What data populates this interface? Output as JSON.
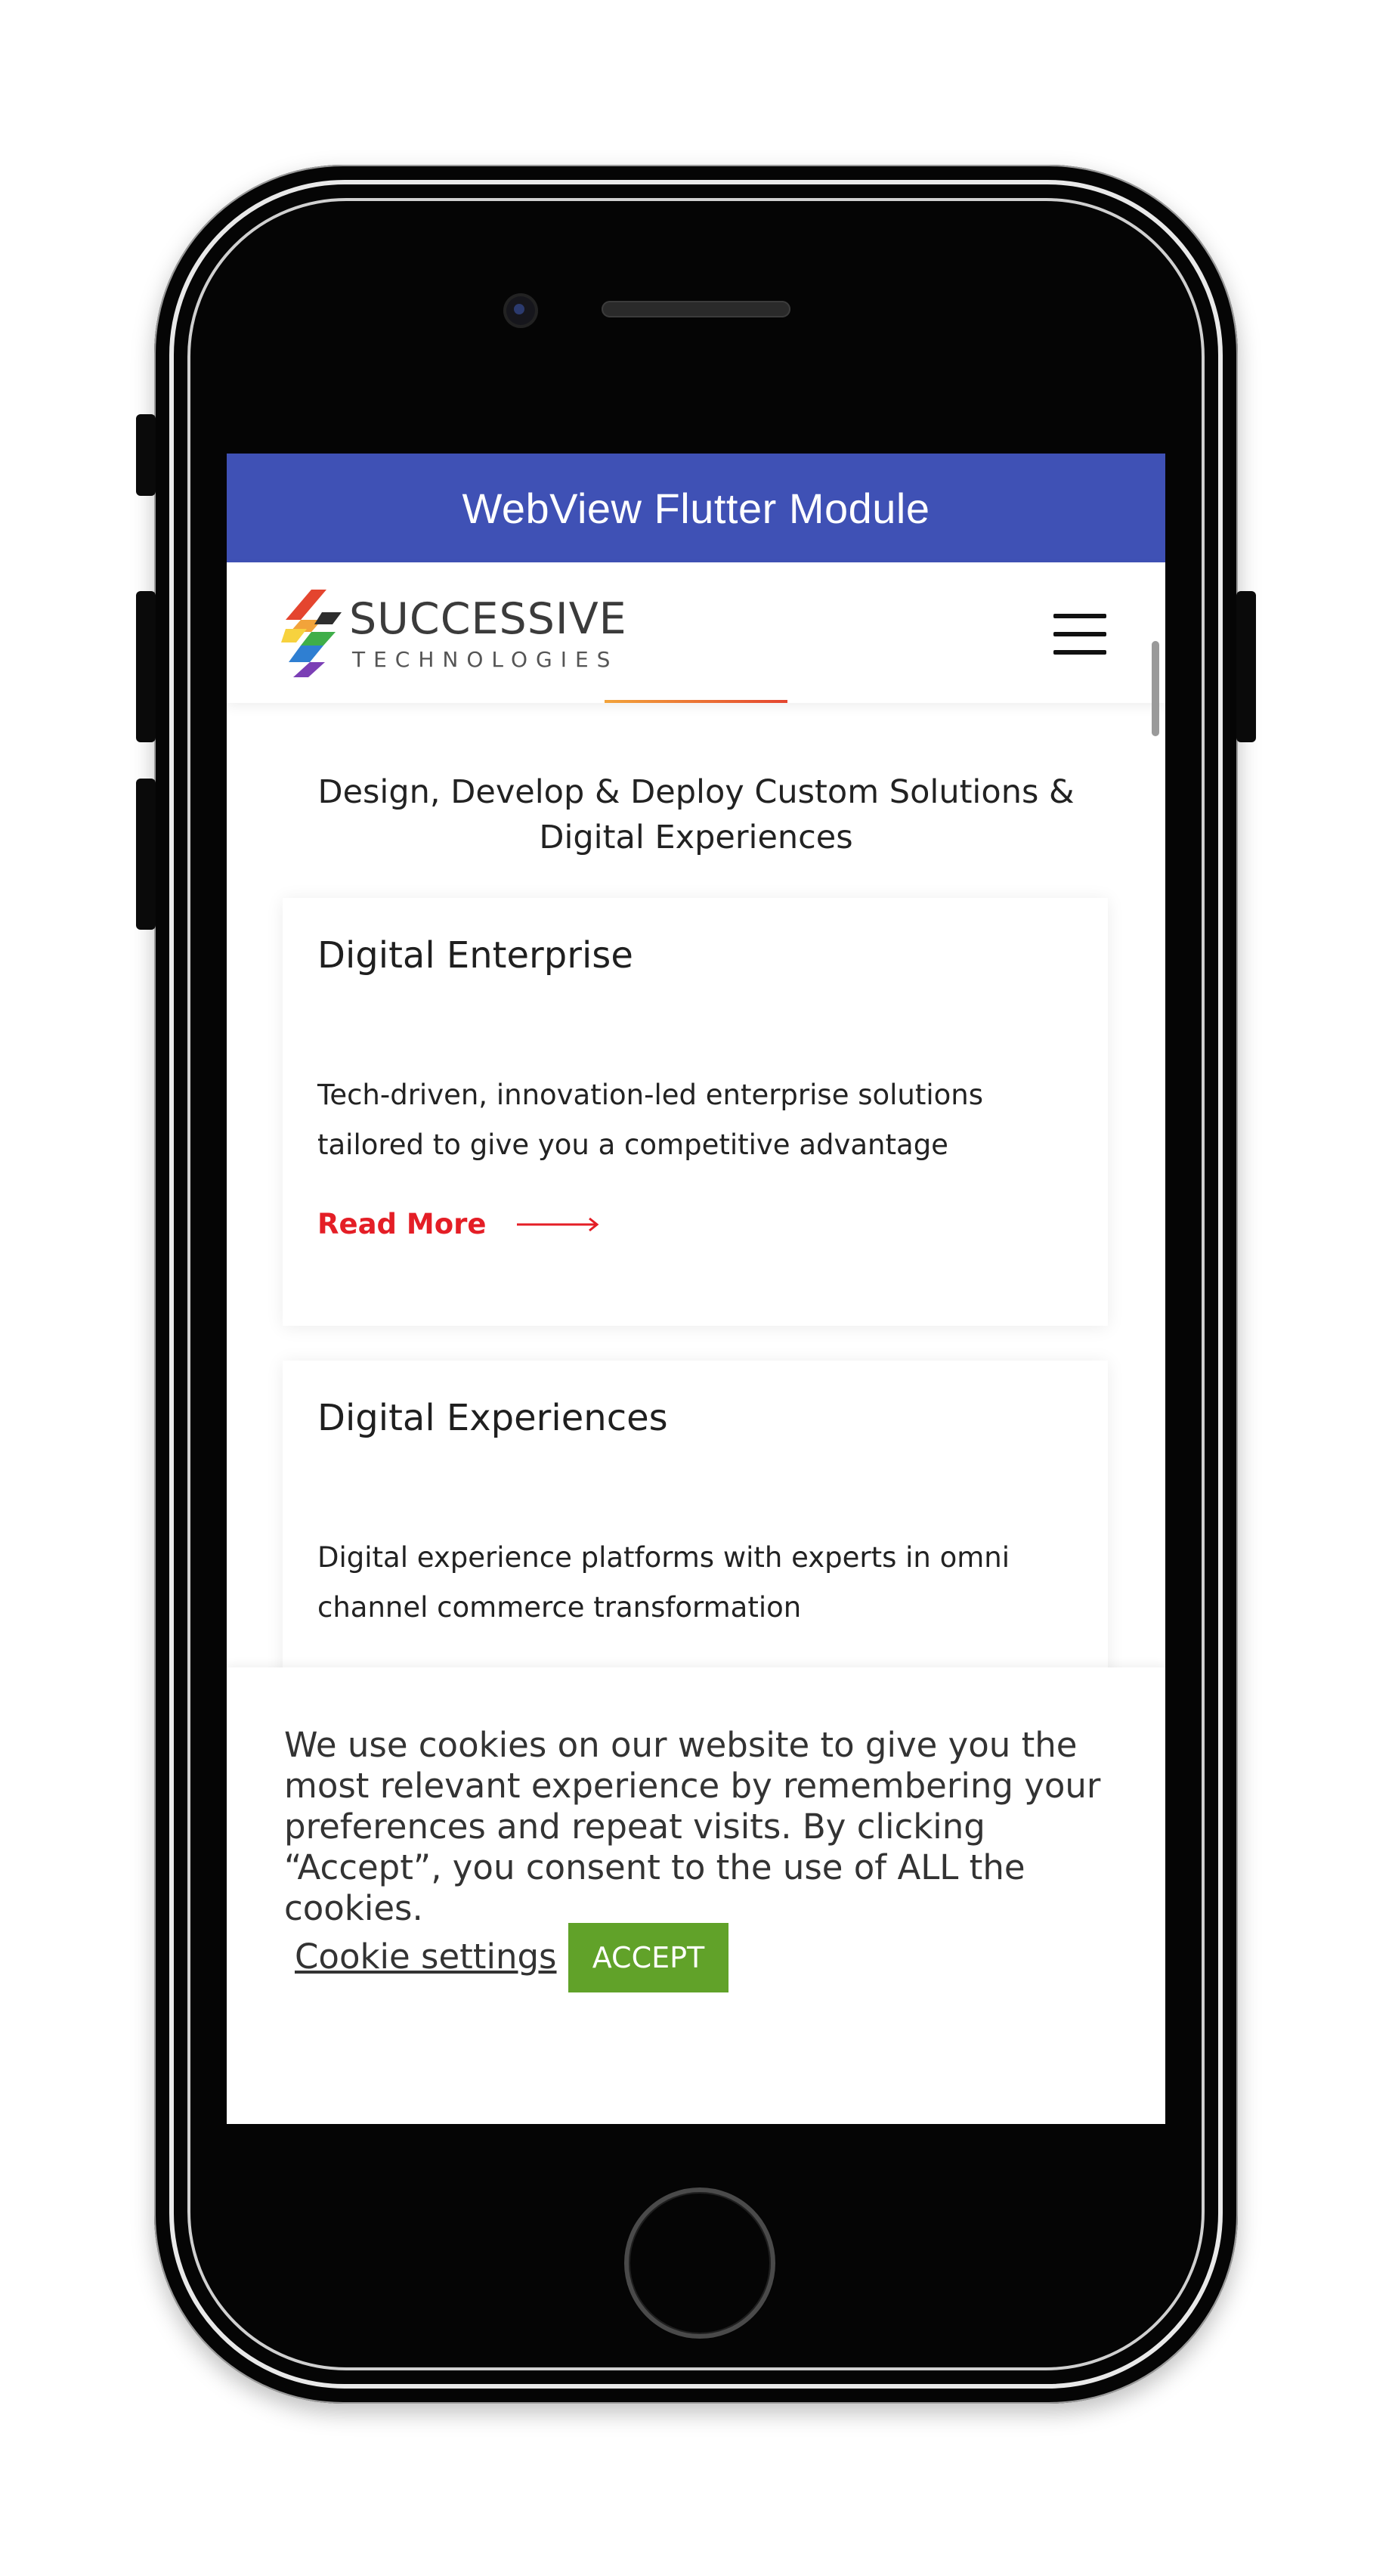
{
  "app_bar": {
    "title": "WebView Flutter Module"
  },
  "site_header": {
    "logo_line1": "SUCCESSIVE",
    "logo_line2": "TECHNOLOGIES",
    "menu_icon": "hamburger-menu-icon"
  },
  "tagline": "Design, Develop & Deploy Custom Solutions & Digital Experiences",
  "cards": [
    {
      "title": "Digital Enterprise",
      "description": "Tech-driven, innovation-led enterprise solutions tailored to give you a competitive advantage",
      "link_label": "Read More",
      "link_icon": "arrow-right-icon"
    },
    {
      "title": "Digital Experiences",
      "description": "Digital experience platforms with experts in omni channel commerce transformation"
    }
  ],
  "cookie_banner": {
    "message": "We use cookies on our website to give you the most relevant experience by remembering your preferences and repeat visits. By clicking “Accept”, you consent to the use of ALL the cookies.",
    "settings_label": "Cookie settings",
    "accept_label": "ACCEPT"
  },
  "colors": {
    "app_bar": "#3f51b5",
    "link_red": "#e41e26",
    "accept_green": "#61a229"
  }
}
